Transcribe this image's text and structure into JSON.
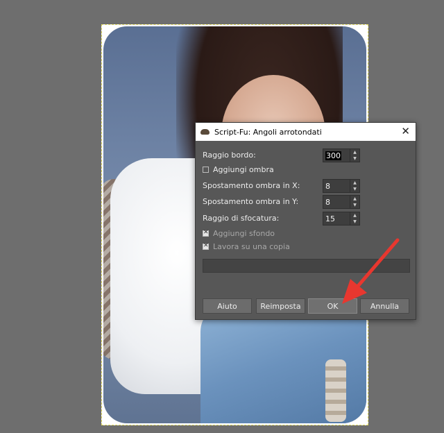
{
  "dialog": {
    "title": "Script-Fu: Angoli arrotondati",
    "fields": {
      "raggio_bordo": {
        "label": "Raggio bordo:",
        "value": "300"
      },
      "aggiungi_ombra": {
        "label": "Aggiungi ombra",
        "checked": false
      },
      "spostamento_x": {
        "label": "Spostamento ombra in X:",
        "value": "8"
      },
      "spostamento_y": {
        "label": "Spostamento ombra in Y:",
        "value": "8"
      },
      "raggio_sfocatura": {
        "label": "Raggio di sfocatura:",
        "value": "15"
      },
      "aggiungi_sfondo": {
        "label": "Aggiungi sfondo",
        "checked": true
      },
      "lavora_copia": {
        "label": "Lavora su una copia",
        "checked": true
      }
    },
    "buttons": {
      "help": "Aiuto",
      "reset": "Reimposta",
      "ok": "OK",
      "cancel": "Annulla"
    }
  },
  "colors": {
    "canvas_bg": "#6e6e6e",
    "dialog_bg": "#575757",
    "arrow": "#e8372f"
  },
  "icons": {
    "app": "gimp-wilber-icon",
    "close": "close-icon"
  }
}
